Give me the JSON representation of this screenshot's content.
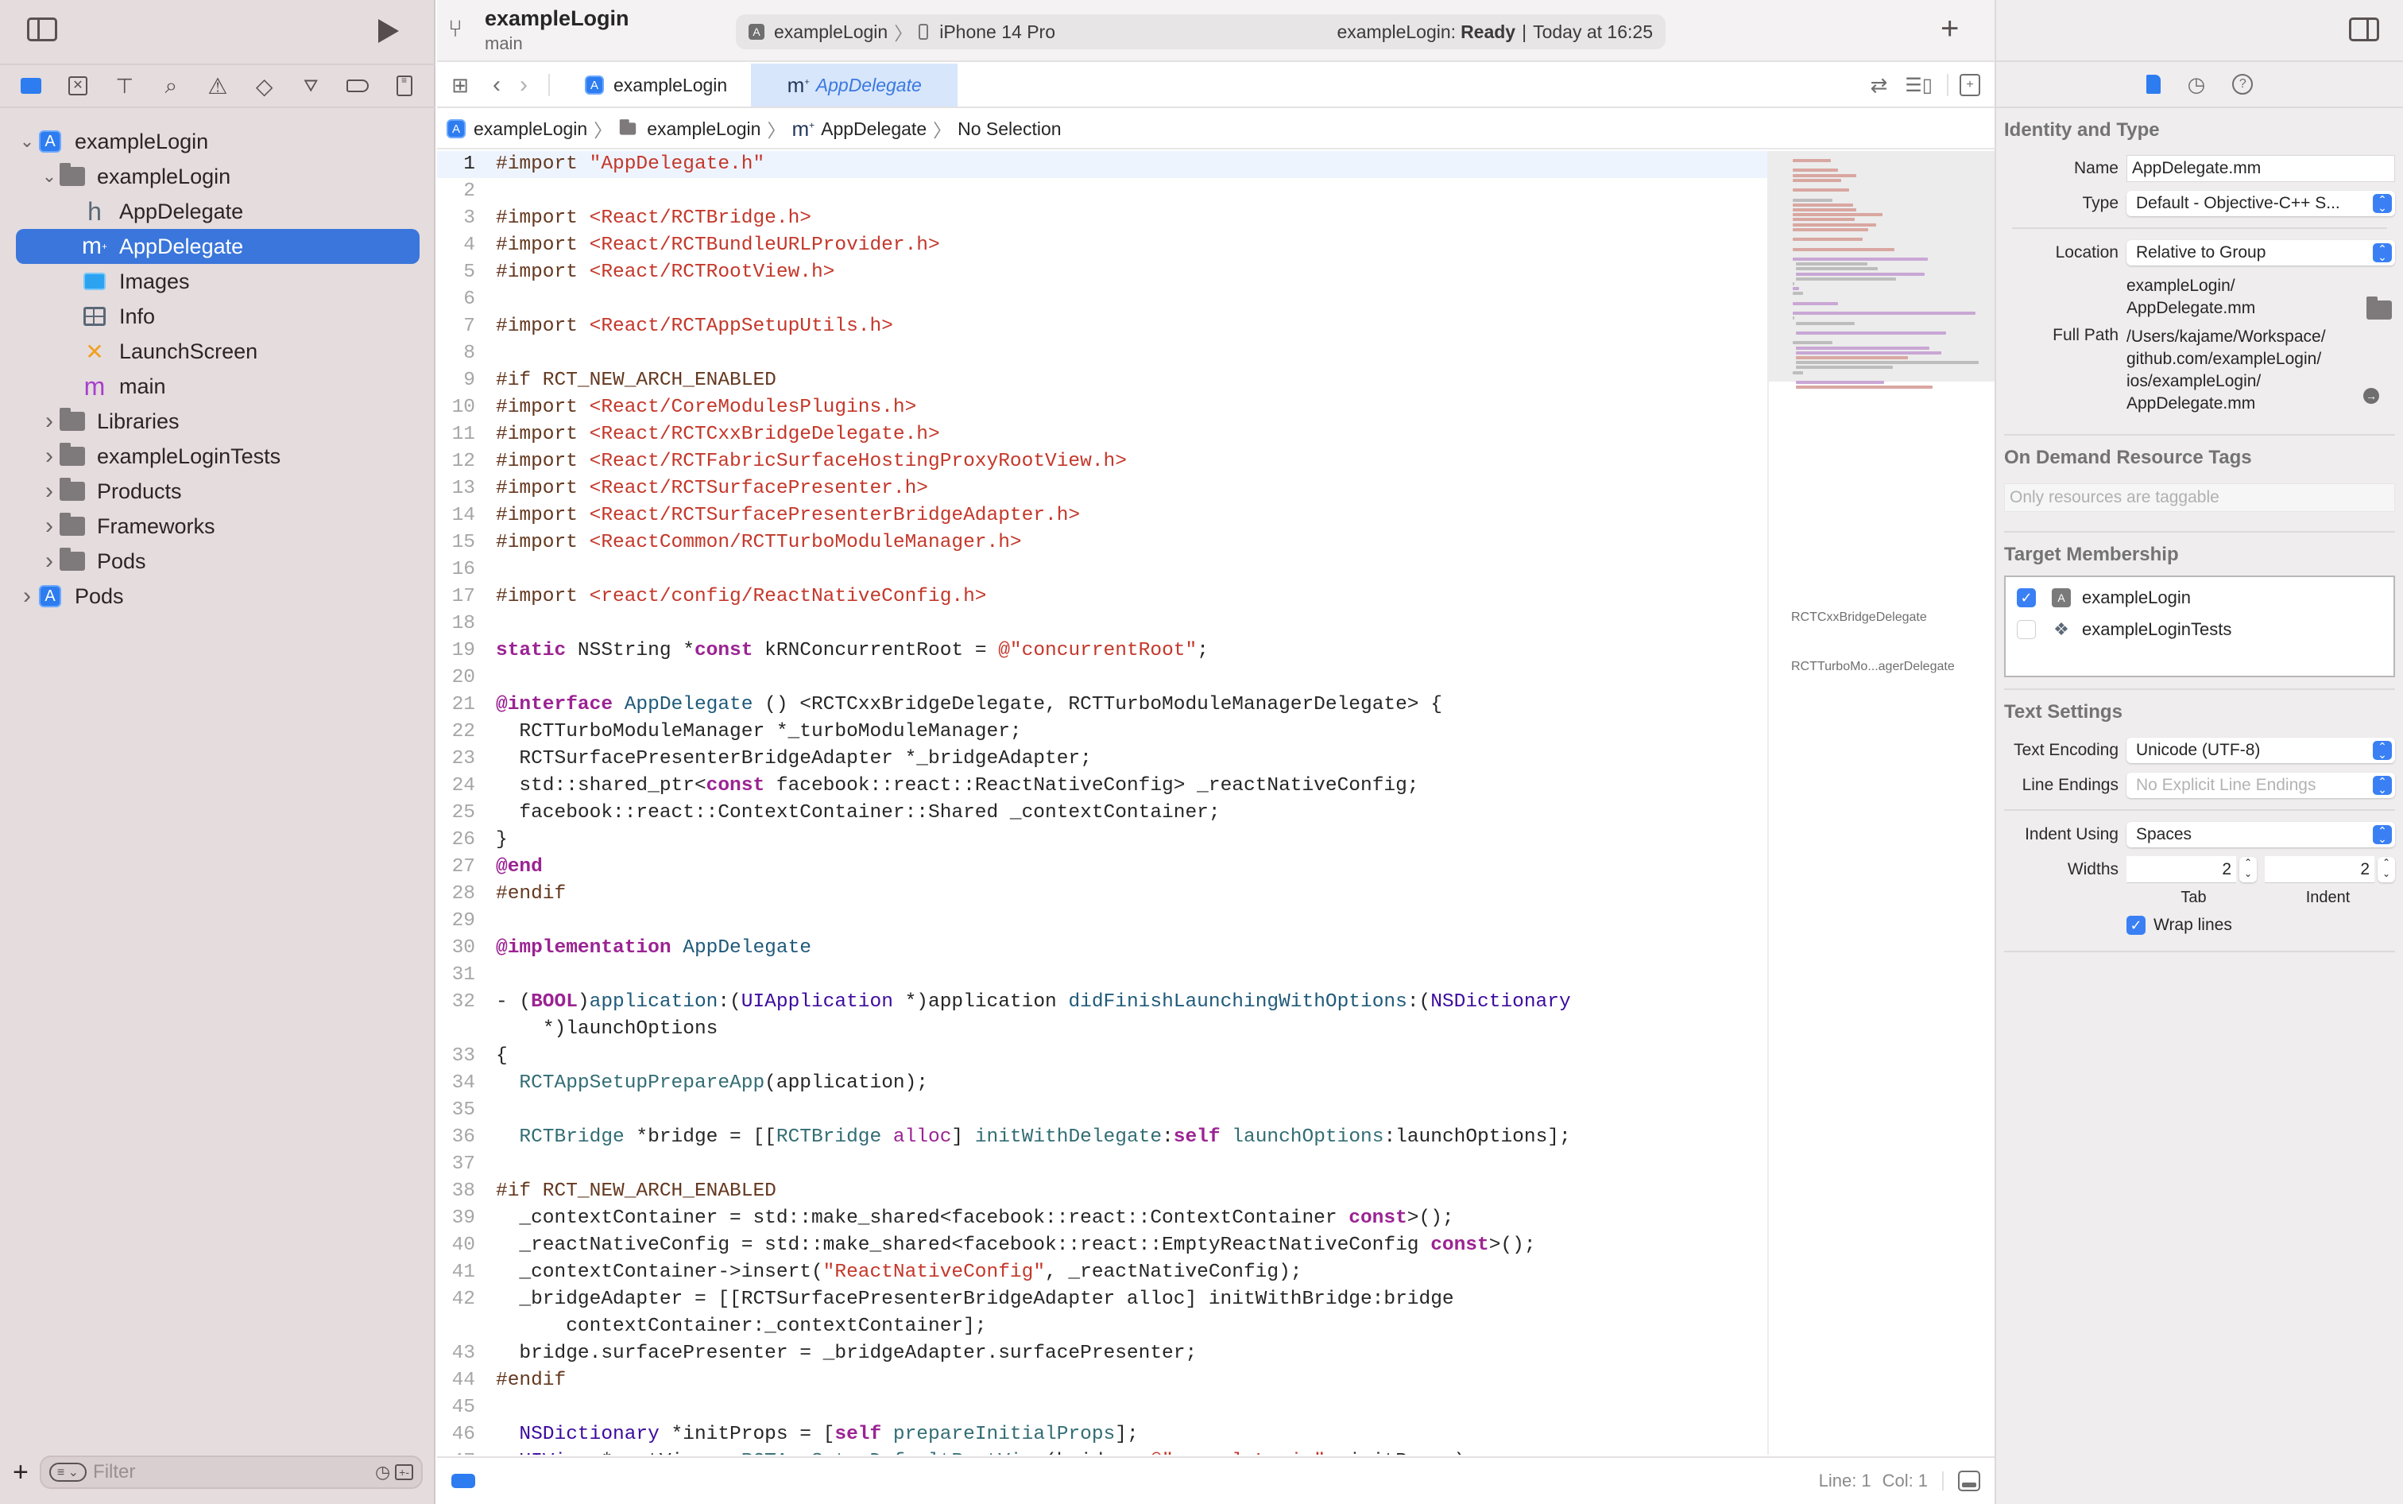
{
  "toolbar": {
    "project_name": "exampleLogin",
    "branch": "main",
    "scheme_target": "exampleLogin",
    "scheme_device": "iPhone 14 Pro",
    "status_project": "exampleLogin:",
    "status_state": "Ready",
    "status_time": "Today at 16:25"
  },
  "navigator": {
    "tree": [
      {
        "label": "exampleLogin",
        "depth": 0,
        "icon": "app-project-icon",
        "disclosure": "expanded"
      },
      {
        "label": "exampleLogin",
        "depth": 1,
        "icon": "folder-icon",
        "disclosure": "expanded"
      },
      {
        "label": "AppDelegate",
        "depth": 2,
        "icon": "header-file-icon",
        "glyph": "h",
        "disclosure": "none"
      },
      {
        "label": "AppDelegate",
        "depth": 2,
        "icon": "objcpp-file-icon",
        "glyph": "m⁺",
        "disclosure": "none",
        "selected": true
      },
      {
        "label": "Images",
        "depth": 2,
        "icon": "asset-catalog-icon",
        "disclosure": "none"
      },
      {
        "label": "Info",
        "depth": 2,
        "icon": "plist-icon",
        "disclosure": "none"
      },
      {
        "label": "LaunchScreen",
        "depth": 2,
        "icon": "storyboard-icon",
        "disclosure": "none"
      },
      {
        "label": "main",
        "depth": 2,
        "icon": "objc-file-icon",
        "glyph": "m",
        "disclosure": "none"
      },
      {
        "label": "Libraries",
        "depth": 1,
        "icon": "folder-icon",
        "disclosure": "collapsed"
      },
      {
        "label": "exampleLoginTests",
        "depth": 1,
        "icon": "folder-icon",
        "disclosure": "collapsed"
      },
      {
        "label": "Products",
        "depth": 1,
        "icon": "folder-icon",
        "disclosure": "collapsed"
      },
      {
        "label": "Frameworks",
        "depth": 1,
        "icon": "folder-icon",
        "disclosure": "collapsed"
      },
      {
        "label": "Pods",
        "depth": 1,
        "icon": "folder-icon",
        "disclosure": "collapsed"
      },
      {
        "label": "Pods",
        "depth": 0,
        "icon": "app-project-icon",
        "disclosure": "collapsed"
      }
    ],
    "filter_placeholder": "Filter"
  },
  "editor": {
    "tabs": [
      {
        "label": "exampleLogin",
        "icon": "app-project-icon",
        "active": false
      },
      {
        "label": "AppDelegate",
        "icon": "objcpp-file-icon",
        "active": true
      }
    ],
    "breadcrumb": [
      "exampleLogin",
      "exampleLogin",
      "AppDelegate",
      "No Selection"
    ],
    "current_line": 1,
    "lines": [
      {
        "n": "1",
        "html": "<span class='p'>#import </span><span class='s'>\"AppDelegate.h\"</span>"
      },
      {
        "n": "2",
        "html": ""
      },
      {
        "n": "3",
        "html": "<span class='p'>#import </span><span class='s'>&lt;React/RCTBridge.h&gt;</span>"
      },
      {
        "n": "4",
        "html": "<span class='p'>#import </span><span class='s'>&lt;React/RCTBundleURLProvider.h&gt;</span>"
      },
      {
        "n": "5",
        "html": "<span class='p'>#import </span><span class='s'>&lt;React/RCTRootView.h&gt;</span>"
      },
      {
        "n": "6",
        "html": ""
      },
      {
        "n": "7",
        "html": "<span class='p'>#import </span><span class='s'>&lt;React/RCTAppSetupUtils.h&gt;</span>"
      },
      {
        "n": "8",
        "html": ""
      },
      {
        "n": "9",
        "html": "<span class='p'>#if RCT_NEW_ARCH_ENABLED</span>"
      },
      {
        "n": "10",
        "html": "<span class='p'>#import </span><span class='s'>&lt;React/CoreModulesPlugins.h&gt;</span>"
      },
      {
        "n": "11",
        "html": "<span class='p'>#import </span><span class='s'>&lt;React/RCTCxxBridgeDelegate.h&gt;</span>"
      },
      {
        "n": "12",
        "html": "<span class='p'>#import </span><span class='s'>&lt;React/RCTFabricSurfaceHostingProxyRootView.h&gt;</span>"
      },
      {
        "n": "13",
        "html": "<span class='p'>#import </span><span class='s'>&lt;React/RCTSurfacePresenter.h&gt;</span>"
      },
      {
        "n": "14",
        "html": "<span class='p'>#import </span><span class='s'>&lt;React/RCTSurfacePresenterBridgeAdapter.h&gt;</span>"
      },
      {
        "n": "15",
        "html": "<span class='p'>#import </span><span class='s'>&lt;ReactCommon/RCTTurboModuleManager.h&gt;</span>"
      },
      {
        "n": "16",
        "html": ""
      },
      {
        "n": "17",
        "html": "<span class='p'>#import </span><span class='s'>&lt;react/config/ReactNativeConfig.h&gt;</span>"
      },
      {
        "n": "18",
        "html": ""
      },
      {
        "n": "19",
        "html": "<span class='k'>static</span> NSString *<span class='k'>const</span> kRNConcurrentRoot = <span class='s'>@\"concurrentRoot\"</span>;"
      },
      {
        "n": "20",
        "html": ""
      },
      {
        "n": "21",
        "html": "<span class='k'>@interface</span> <span class='c'>AppDelegate</span> () &lt;RCTCxxBridgeDelegate, RCTTurboModuleManagerDelegate&gt; {"
      },
      {
        "n": "22",
        "html": "  RCTTurboModuleManager *_turboModuleManager;"
      },
      {
        "n": "23",
        "html": "  RCTSurfacePresenterBridgeAdapter *_bridgeAdapter;"
      },
      {
        "n": "24",
        "html": "  std::shared_ptr&lt;<span class='k'>const</span> facebook::react::ReactNativeConfig&gt; _reactNativeConfig;"
      },
      {
        "n": "25",
        "html": "  facebook::react::ContextContainer::Shared _contextContainer;"
      },
      {
        "n": "26",
        "html": "}"
      },
      {
        "n": "27",
        "html": "<span class='k'>@end</span>"
      },
      {
        "n": "28",
        "html": "<span class='p'>#endif</span>"
      },
      {
        "n": "29",
        "html": ""
      },
      {
        "n": "30",
        "html": "<span class='k'>@implementation</span> <span class='c'>AppDelegate</span>"
      },
      {
        "n": "31",
        "html": ""
      },
      {
        "n": "32",
        "html": "- (<span class='k'>BOOL</span>)<span class='c'>application</span>:(<span class='t'>UIApplication</span> *)application <span class='c'>didFinishLaunchingWithOptions</span>:(<span class='t'>NSDictionary</span>\n    *)launchOptions"
      },
      {
        "n": "33",
        "html": "{"
      },
      {
        "n": "34",
        "html": "  <span class='f'>RCTAppSetupPrepareApp</span>(application);"
      },
      {
        "n": "35",
        "html": ""
      },
      {
        "n": "36",
        "html": "  <span class='f'>RCTBridge</span> *bridge = [[<span class='f'>RCTBridge</span> <span class='k' style='font-weight:normal'>alloc</span>] <span class='f'>initWithDelegate</span>:<span class='k'>self</span> <span class='f'>launchOptions</span>:launchOptions];"
      },
      {
        "n": "37",
        "html": ""
      },
      {
        "n": "38",
        "html": "<span class='p'>#if RCT_NEW_ARCH_ENABLED</span>"
      },
      {
        "n": "39",
        "html": "  _contextContainer = std::make_shared&lt;facebook::react::ContextContainer <span class='k'>const</span>&gt;();"
      },
      {
        "n": "40",
        "html": "  _reactNativeConfig = std::make_shared&lt;facebook::react::EmptyReactNativeConfig <span class='k'>const</span>&gt;();"
      },
      {
        "n": "41",
        "html": "  _contextContainer-&gt;insert(<span class='s'>\"ReactNativeConfig\"</span>, _reactNativeConfig);"
      },
      {
        "n": "42",
        "html": "  _bridgeAdapter = [[RCTSurfacePresenterBridgeAdapter alloc] initWithBridge:bridge\n      contextContainer:_contextContainer];"
      },
      {
        "n": "43",
        "html": "  bridge.surfacePresenter = _bridgeAdapter.surfacePresenter;"
      },
      {
        "n": "44",
        "html": "<span class='p'>#endif</span>"
      },
      {
        "n": "45",
        "html": ""
      },
      {
        "n": "46",
        "html": "  <span class='t'>NSDictionary</span> *initProps = [<span class='k'>self</span> <span class='f'>prepareInitialProps</span>];"
      },
      {
        "n": "47",
        "html": "  <span class='t'>UIView</span> *rootView = <span class='f'>RCTAppSetupDefaultRootView</span>(bridge, <span class='s'>@\"exampleLogin\"</span>, initProps);"
      }
    ],
    "minimap_labels": [
      "RCTCxxBridgeDelegate",
      "RCTTurboMo...agerDelegate"
    ],
    "cursor": {
      "line_label": "Line:",
      "line": "1",
      "col_label": "Col:",
      "col": "1"
    }
  },
  "inspector": {
    "identity": {
      "title": "Identity and Type",
      "name_label": "Name",
      "name_value": "AppDelegate.mm",
      "type_label": "Type",
      "type_value": "Default - Objective-C++ S...",
      "location_label": "Location",
      "location_value": "Relative to Group",
      "relative_path": "exampleLogin/\nAppDelegate.mm",
      "fullpath_label": "Full Path",
      "fullpath_value": "/Users/kajame/Workspace/\ngithub.com/exampleLogin/\nios/exampleLogin/\nAppDelegate.mm"
    },
    "odr": {
      "title": "On Demand Resource Tags",
      "placeholder": "Only resources are taggable"
    },
    "membership": {
      "title": "Target Membership",
      "targets": [
        {
          "label": "exampleLogin",
          "checked": true,
          "icon": "app-target-icon"
        },
        {
          "label": "exampleLoginTests",
          "checked": false,
          "icon": "test-target-icon"
        }
      ]
    },
    "text_settings": {
      "title": "Text Settings",
      "encoding_label": "Text Encoding",
      "encoding_value": "Unicode (UTF-8)",
      "endings_label": "Line Endings",
      "endings_value": "No Explicit Line Endings",
      "indent_label": "Indent Using",
      "indent_value": "Spaces",
      "widths_label": "Widths",
      "tab_value": "2",
      "tab_label": "Tab",
      "indent_width_value": "2",
      "indent_width_label": "Indent",
      "wrap_label": "Wrap lines",
      "wrap_checked": true
    }
  },
  "colors": {
    "accent": "#3a76db",
    "nav_bg": "#e5dcdd",
    "inspector_bg": "#efedee",
    "string": "#c4372a",
    "keyword": "#9b2393",
    "preprocessor": "#643820"
  }
}
